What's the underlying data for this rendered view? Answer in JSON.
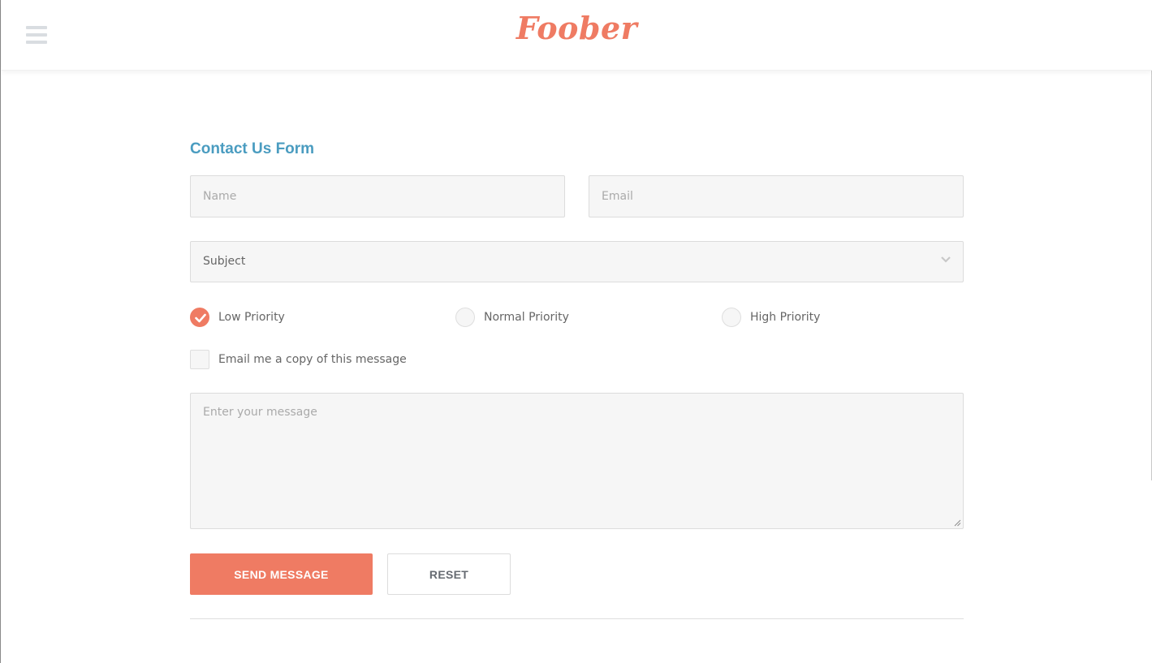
{
  "header": {
    "logo_text": "Foober",
    "menu_icon": "hamburger-menu-icon"
  },
  "form": {
    "title": "Contact Us Form",
    "name_placeholder": "Name",
    "email_placeholder": "Email",
    "subject_value": "Subject",
    "priority_options": [
      {
        "label": "Low Priority",
        "checked": true
      },
      {
        "label": "Normal Priority",
        "checked": false
      },
      {
        "label": "High Priority",
        "checked": false
      }
    ],
    "copy_checkbox_label": "Email me a copy of this message",
    "copy_checked": false,
    "message_placeholder": "Enter your message",
    "send_label": "SEND MESSAGE",
    "reset_label": "RESET"
  },
  "colors": {
    "accent": "#ef7b63",
    "title_blue": "#4a9cc0"
  }
}
